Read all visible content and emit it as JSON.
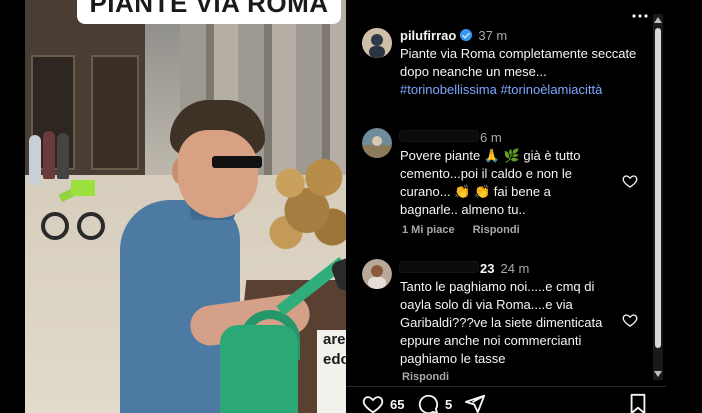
{
  "media": {
    "caption": "PIANTE VIA ROMA",
    "sign_text": [
      "area",
      "edona"
    ]
  },
  "post": {
    "username": "pilufirrao",
    "time": "37 m",
    "text": "Piante via Roma completamente seccate dopo neanche un mese...",
    "hashtags": [
      "#torinobellissima",
      "#torinoèlamiacittà"
    ]
  },
  "comments": [
    {
      "username_hidden": true,
      "time": "6 m",
      "text": "Povere piante 🙏 🌿 già è tutto cemento...poi il caldo e non le curano... 👏 👏 fai bene a bagnarle.. almeno tu..",
      "likes_label": "1 Mi piace",
      "reply_label": "Rispondi"
    },
    {
      "username_suffix": "23",
      "time": "24 m",
      "text": "Tanto le paghiamo noi.....e cmq di oayla solo di via Roma....e via Garibaldi???ve la siete dimenticata eppure anche noi commercianti paghiamo le tasse",
      "reply_label": "Rispondi"
    }
  ],
  "actions": {
    "likes": "65",
    "comments": "5"
  },
  "colors": {
    "hashtag": "#7ea7ff",
    "verified": "#3897f0",
    "background": "#000000"
  }
}
